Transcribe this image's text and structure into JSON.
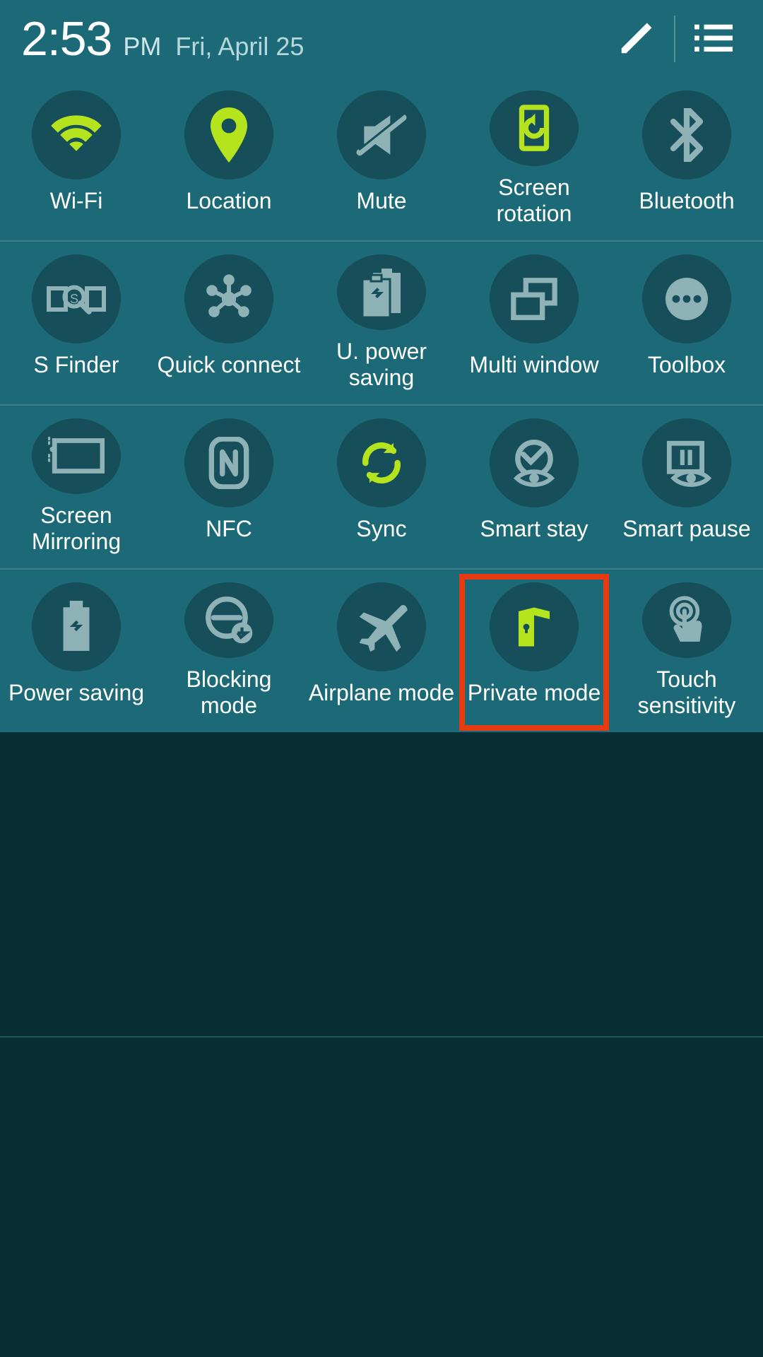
{
  "colors": {
    "panel": "#1c6a77",
    "circle": "#164f59",
    "active": "#b5e41f",
    "inactive": "#8fb2b7",
    "highlight": "#e53a12"
  },
  "header": {
    "time": "2:53",
    "ampm": "PM",
    "date": "Fri, April 25",
    "pencil_tooltip": "Edit",
    "list_tooltip": "List"
  },
  "tiles": [
    {
      "id": "wifi",
      "label": "Wi-Fi",
      "active": true,
      "icon": "wifi"
    },
    {
      "id": "location",
      "label": "Location",
      "active": true,
      "icon": "location"
    },
    {
      "id": "mute",
      "label": "Mute",
      "active": false,
      "icon": "mute"
    },
    {
      "id": "screen-rotation",
      "label": "Screen rotation",
      "active": true,
      "icon": "rotation"
    },
    {
      "id": "bluetooth",
      "label": "Bluetooth",
      "active": false,
      "icon": "bluetooth"
    },
    {
      "id": "s-finder",
      "label": "S Finder",
      "active": false,
      "icon": "sfinder"
    },
    {
      "id": "quick-connect",
      "label": "Quick connect",
      "active": false,
      "icon": "quickconnect"
    },
    {
      "id": "u-power-saving",
      "label": "U. power saving",
      "active": false,
      "icon": "upowersaving"
    },
    {
      "id": "multi-window",
      "label": "Multi window",
      "active": false,
      "icon": "multiwindow"
    },
    {
      "id": "toolbox",
      "label": "Toolbox",
      "active": false,
      "icon": "toolbox"
    },
    {
      "id": "screen-mirroring",
      "label": "Screen Mirroring",
      "active": false,
      "icon": "mirroring"
    },
    {
      "id": "nfc",
      "label": "NFC",
      "active": false,
      "icon": "nfc"
    },
    {
      "id": "sync",
      "label": "Sync",
      "active": true,
      "icon": "sync"
    },
    {
      "id": "smart-stay",
      "label": "Smart stay",
      "active": false,
      "icon": "smartstay"
    },
    {
      "id": "smart-pause",
      "label": "Smart pause",
      "active": false,
      "icon": "smartpause"
    },
    {
      "id": "power-saving",
      "label": "Power saving",
      "active": false,
      "icon": "powersaving"
    },
    {
      "id": "blocking-mode",
      "label": "Blocking mode",
      "active": false,
      "icon": "blocking"
    },
    {
      "id": "airplane-mode",
      "label": "Airplane mode",
      "active": false,
      "icon": "airplane"
    },
    {
      "id": "private-mode",
      "label": "Private mode",
      "active": true,
      "icon": "private",
      "highlighted": true
    },
    {
      "id": "touch-sensitivity",
      "label": "Touch sensitivity",
      "active": false,
      "icon": "touch"
    }
  ]
}
